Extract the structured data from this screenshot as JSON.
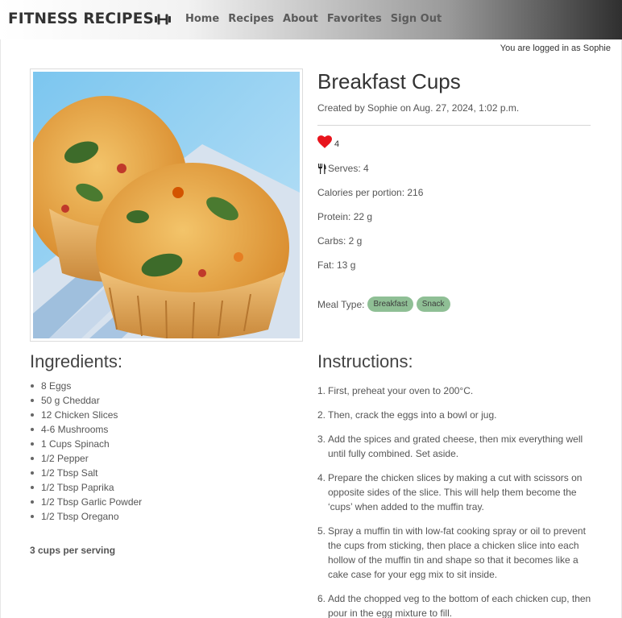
{
  "brand": {
    "name": "FITNESS RECIPES",
    "icon": "dumbbell-icon"
  },
  "nav": {
    "links": [
      "Home",
      "Recipes",
      "About",
      "Favorites",
      "Sign Out"
    ]
  },
  "login_note": "You are logged in as Sophie",
  "recipe": {
    "title": "Breakfast Cups",
    "created": "Created by Sophie on Aug. 27, 2024, 1:02 p.m.",
    "likes": "4",
    "serves": "Serves: 4",
    "calories": "Calories per portion: 216",
    "protein": "Protein: 22 g",
    "carbs": "Carbs: 2 g",
    "fat": "Fat: 13 g",
    "meal_type_label": "Meal Type:",
    "meal_types": [
      "Breakfast",
      "Snack"
    ],
    "ingredients_heading": "Ingredients:",
    "ingredients": [
      "8 Eggs",
      "50 g Cheddar",
      "12 Chicken Slices",
      "4-6 Mushrooms",
      "1 Cups Spinach",
      "1/2 Pepper",
      "1/2 Tbsp Salt",
      "1/2 Tbsp Paprika",
      "1/2 Tbsp Garlic Powder",
      "1/2 Tbsp Oregano"
    ],
    "per_serving": "3 cups per serving",
    "instructions_heading": "Instructions:",
    "instructions": [
      "First, preheat your oven to 200°C.",
      "Then, crack the eggs into a bowl or jug.",
      "Add the spices and grated cheese, then mix everything well until fully combined. Set aside.",
      "Prepare the chicken slices by making a cut with scissors on opposite sides of the slice. This will help them become the ‘cups’ when added to the muffin tray.",
      "Spray a muffin tin with low-fat cooking spray or oil to prevent the cups from sticking, then place a chicken slice into each hollow of the muffin tin and shape so that it becomes like a cake case for your egg mix to sit inside.",
      "Add the chopped veg to the bottom of each chicken cup, then pour in the egg mixture to fill."
    ]
  },
  "colors": {
    "heart": "#e8141c",
    "tag": "#8fbf95"
  },
  "icons": {
    "likes": "heart-icon",
    "serves": "cutlery-icon"
  }
}
